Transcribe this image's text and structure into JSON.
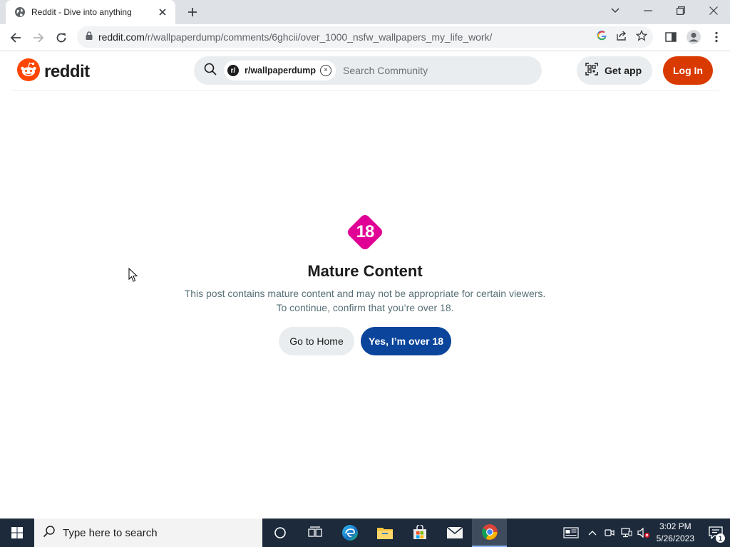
{
  "browser": {
    "tab_title": "Reddit - Dive into anything",
    "url_host": "reddit.com",
    "url_path": "/r/wallpaperdump/comments/6ghcii/over_1000_nsfw_wallpapers_my_life_work/"
  },
  "reddit_header": {
    "logo_text": "reddit",
    "community_chip": "r/wallpaperdump",
    "search_placeholder": "Search Community",
    "get_app_label": "Get app",
    "login_label": "Log In"
  },
  "mature_notice": {
    "badge_text": "18",
    "title": "Mature Content",
    "line1": "This post contains mature content and may not be appropriate for certain viewers.",
    "line2": "To continue, confirm that you’re over 18.",
    "home_button": "Go to Home",
    "confirm_button": "Yes, I’m over 18"
  },
  "taskbar": {
    "search_placeholder": "Type here to search",
    "time": "3:02 PM",
    "date": "5/26/2023",
    "notification_count": "1"
  },
  "colors": {
    "reddit_orange": "#d93a00",
    "confirm_blue": "#0a449b",
    "nsfw_pink": "#e00096"
  }
}
